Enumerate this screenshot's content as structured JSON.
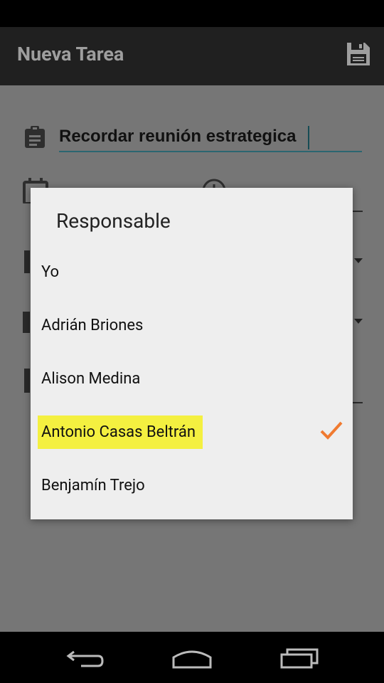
{
  "app_bar": {
    "title": "Nueva Tarea",
    "save_icon": "save-icon"
  },
  "form": {
    "task_icon": "clipboard-icon",
    "task_value": "Recordar reunión estrategica"
  },
  "dialog": {
    "title": "Responsable",
    "selected": "Antonio Casas Beltrán",
    "items": [
      {
        "label": "Yo"
      },
      {
        "label": "Adrián Briones"
      },
      {
        "label": "Alison Medina"
      },
      {
        "label": "Antonio Casas Beltrán"
      },
      {
        "label": "Benjamín Trejo"
      }
    ],
    "highlight_color": "#f4f040",
    "check_color": "#f07a30"
  },
  "nav": {
    "back_icon": "back-icon",
    "home_icon": "home-icon",
    "recents_icon": "recents-icon"
  }
}
